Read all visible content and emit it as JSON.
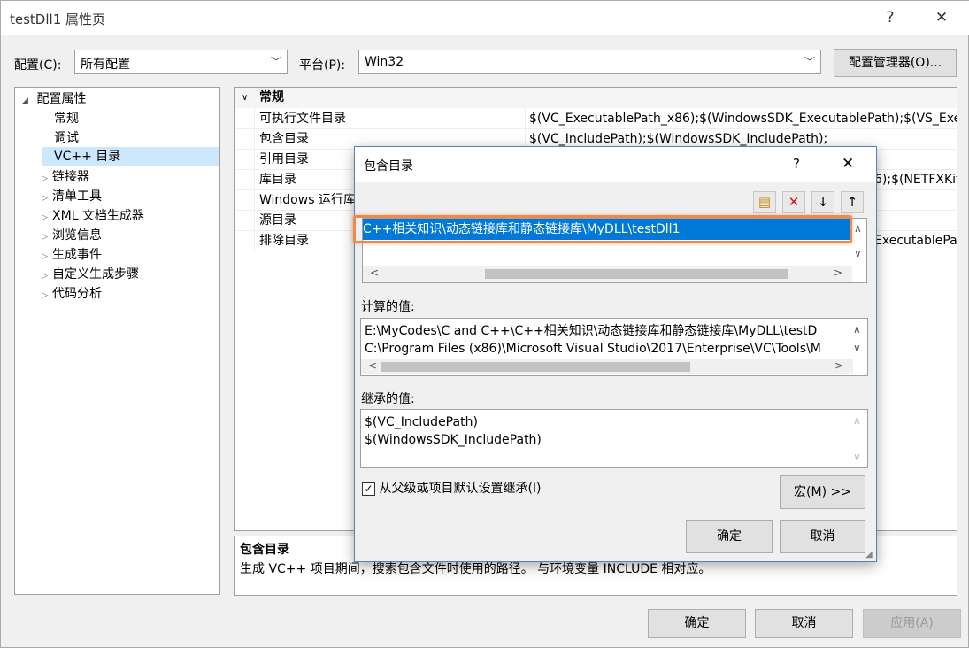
{
  "window": {
    "title": "testDll1 属性页",
    "help_label": "?",
    "close_label": "✕"
  },
  "toolbar": {
    "config_label": "配置(C):",
    "config_value": "所有配置",
    "platform_label": "平台(P):",
    "platform_value": "Win32",
    "config_manager_label": "配置管理器(O)..."
  },
  "tree": {
    "root_label": "配置属性",
    "items": [
      "常规",
      "调试",
      "VC++ 目录",
      "链接器",
      "清单工具",
      "XML 文档生成器",
      "浏览信息",
      "生成事件",
      "自定义生成步骤",
      "代码分析"
    ]
  },
  "grid": {
    "section_label": "常规",
    "rows": [
      {
        "key": "可执行文件目录",
        "value": "$(VC_ExecutablePath_x86);$(WindowsSDK_ExecutablePath);$(VS_Exe"
      },
      {
        "key": "包含目录",
        "value": "$(VC_IncludePath);$(WindowsSDK_IncludePath);"
      },
      {
        "key": "引用目录",
        "value": ""
      },
      {
        "key": "库目录",
        "value": "6);$(NETFXKit"
      },
      {
        "key": "Windows 运行库",
        "value": ""
      },
      {
        "key": "源目录",
        "value": ""
      },
      {
        "key": "排除目录",
        "value": "ExecutablePa"
      }
    ]
  },
  "description": {
    "title": "包含目录",
    "text": "生成 VC++ 项目期间，搜索包含文件时使用的路径。 与环境变量 INCLUDE 相对应。"
  },
  "dialog": {
    "title": "包含目录",
    "help_label": "?",
    "close_label": "✕",
    "list_item": "C++相关知识\\动态链接库和静态链接库\\MyDLL\\testDll1",
    "evaluated_label": "计算的值:",
    "evaluated_lines": [
      "E:\\MyCodes\\C and C++\\C++相关知识\\动态链接库和静态链接库\\MyDLL\\testD",
      "C:\\Program Files (x86)\\Microsoft Visual Studio\\2017\\Enterprise\\VC\\Tools\\M"
    ],
    "inherited_label": "继承的值:",
    "inherited_lines": [
      "$(VC_IncludePath)",
      "$(WindowsSDK_IncludePath)"
    ],
    "inherit_checkbox_label": "从父级或项目默认设置继承(I)",
    "inherit_checked": true,
    "macro_button": "宏(M) >>",
    "ok_button": "确定",
    "cancel_button": "取消"
  },
  "footer": {
    "ok_label": "确定",
    "cancel_label": "取消",
    "apply_label": "应用(A)"
  }
}
